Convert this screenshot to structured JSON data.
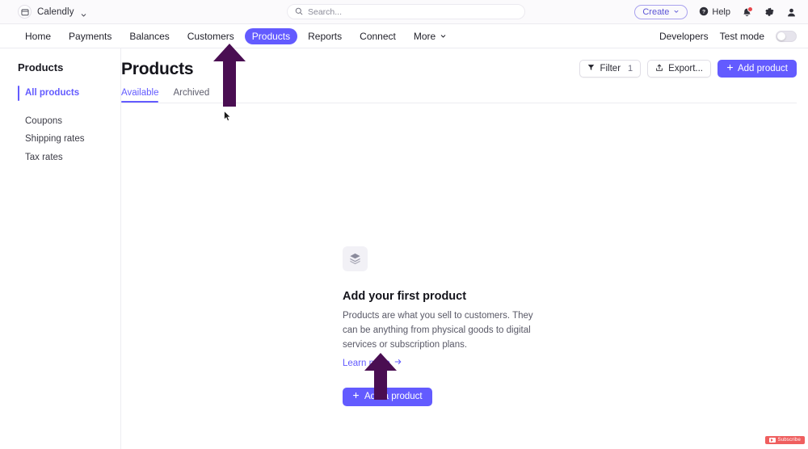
{
  "topbar": {
    "account_name": "Calendly",
    "account_icon": "calendar-icon",
    "chevron_icon": "chevron-down-icon",
    "search": {
      "placeholder": "Search...",
      "value": "",
      "icon": "search-icon"
    },
    "create_label": "Create",
    "help_label": "Help",
    "icons": [
      "help-circle-icon",
      "bell-icon",
      "gear-icon",
      "user-icon"
    ],
    "notification_badge": true
  },
  "nav": {
    "items": [
      {
        "label": "Home",
        "active": false
      },
      {
        "label": "Payments",
        "active": false
      },
      {
        "label": "Balances",
        "active": false
      },
      {
        "label": "Customers",
        "active": false
      },
      {
        "label": "Products",
        "active": true
      },
      {
        "label": "Reports",
        "active": false
      },
      {
        "label": "Connect",
        "active": false
      },
      {
        "label": "More",
        "active": false,
        "caret": true
      }
    ],
    "developers_label": "Developers",
    "test_mode_label": "Test mode",
    "test_mode_on": false
  },
  "sidebar": {
    "title": "Products",
    "items": [
      {
        "label": "All products",
        "active": true
      },
      {
        "label": "Coupons",
        "active": false
      },
      {
        "label": "Shipping rates",
        "active": false
      },
      {
        "label": "Tax rates",
        "active": false
      }
    ]
  },
  "main": {
    "page_title": "Products",
    "tabs": [
      {
        "label": "Available",
        "active": true
      },
      {
        "label": "Archived",
        "active": false
      }
    ],
    "actions": {
      "filter_label": "Filter",
      "filter_count": "1",
      "filter_icon": "funnel-icon",
      "export_label": "Export...",
      "export_icon": "share-icon",
      "add_product_label": "Add product",
      "add_product_icon": "plus-icon"
    },
    "empty_state": {
      "icon": "box-icon",
      "title": "Add your first product",
      "description": "Products are what you sell to customers. They can be anything from physical goods to digital services or subscription plans.",
      "learn_more_label": "Learn more",
      "learn_more_icon": "arrow-right-icon",
      "button_label": "Add a product",
      "button_icon": "plus-icon"
    }
  },
  "annotations": {
    "arrow_color": "#4a0e52",
    "arrow_nav_target": "Products",
    "arrow_button_target": "Add a product"
  },
  "watermark": {
    "label": "Subscribe",
    "color": "#ed4a4a",
    "icon": "youtube-icon"
  }
}
